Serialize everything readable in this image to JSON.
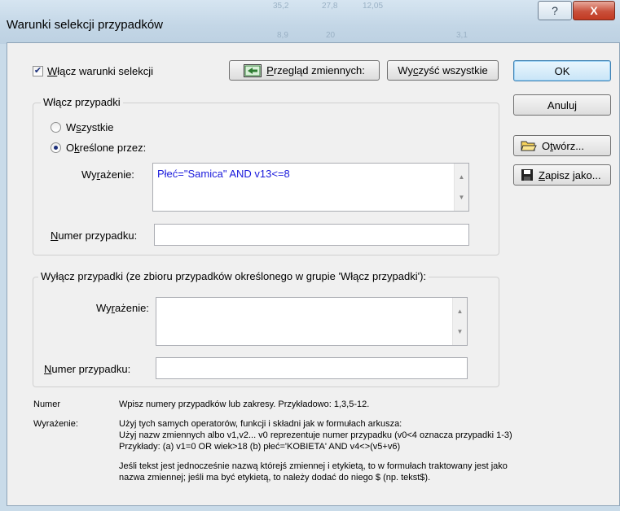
{
  "window": {
    "title": "Warunki selekcji przypadków",
    "help_glyph": "?",
    "close_glyph": "X"
  },
  "enable": {
    "checked": true,
    "pre": "",
    "ul": "W",
    "post": "łącz warunki selekcji"
  },
  "buttons": {
    "browse": {
      "pre": "",
      "ul": "P",
      "post": "rzegląd zmiennych:"
    },
    "clear": {
      "pre": "Wy",
      "ul": "c",
      "post": "zyść wszystkie"
    },
    "ok": "OK",
    "cancel": "Anuluj",
    "open": {
      "pre": "O",
      "ul": "t",
      "post": "wórz..."
    },
    "save": {
      "pre": "",
      "ul": "Z",
      "post": "apisz jako..."
    }
  },
  "include_group": {
    "title": "Włącz przypadki",
    "radio_all": {
      "pre": "W",
      "ul": "s",
      "post": "zystkie",
      "selected": false
    },
    "radio_specified": {
      "pre": "O",
      "ul": "k",
      "post": "reślone przez:",
      "selected": true
    },
    "expr_label": {
      "pre": "Wy",
      "ul": "r",
      "post": "ażenie:"
    },
    "expr_value": "Płeć=\"Samica\" AND v13<=8",
    "case_label": {
      "pre": "",
      "ul": "N",
      "post": "umer przypadku:"
    },
    "case_value": ""
  },
  "exclude_group": {
    "title": "Wyłącz przypadki (ze zbioru przypadków określonego w grupie 'Włącz przypadki'):",
    "expr_label": {
      "pre": "Wy",
      "ul": "r",
      "post": "ażenie:"
    },
    "expr_value": "",
    "case_label": {
      "pre": "",
      "ul": "N",
      "post": "umer przypadku:"
    },
    "case_value": ""
  },
  "help": {
    "numer_label": "Numer",
    "numer_text": "Wpisz numery przypadków lub zakresy. Przykładowo: 1,3,5-12.",
    "wyr_label": "Wyrażenie:",
    "lines": [
      "Użyj tych samych operatorów, funkcji i składni jak w formułach arkusza:",
      "Użyj nazw zmiennych albo v1,v2...   v0 reprezentuje numer przypadku (v0<4 oznacza przypadki 1-3)",
      "Przykłady: (a) v1=0 OR wiek>18   (b) płeć='KOBIETA' AND v4<>(v5+v6)"
    ],
    "note_lines": [
      "Jeśli tekst jest jednocześnie nazwą którejś zmiennej i etykietą, to w formułach traktowany jest jako",
      "nazwa zmiennej; jeśli ma być etykietą, to należy dodać do niego $ (np. tekst$)."
    ]
  },
  "background_fragments": [
    "35,2",
    "27,8",
    "12,05",
    "8,9",
    "20",
    "3,1"
  ],
  "colors": {
    "expression_text": "#1a1adc",
    "accent": "#3c7fb1"
  },
  "icons": {
    "browse": "variables-icon",
    "open": "folder-open-icon",
    "save": "floppy-disk-icon"
  }
}
